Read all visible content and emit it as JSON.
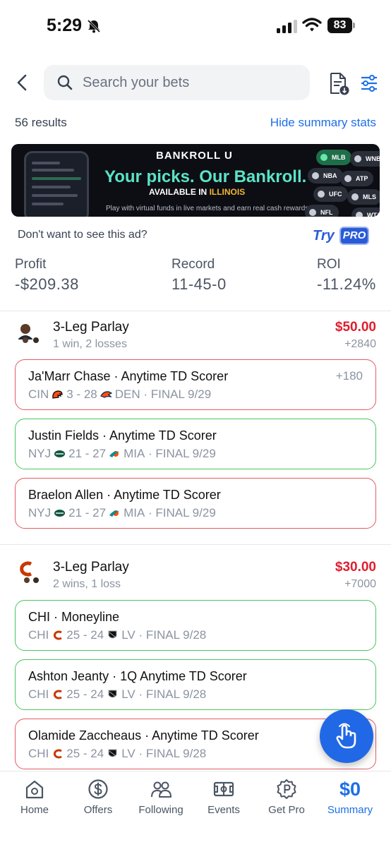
{
  "status_bar": {
    "time": "5:29",
    "battery": "83"
  },
  "header": {
    "search_placeholder": "Search your bets",
    "results_count": "56 results",
    "hide_stats_label": "Hide summary stats"
  },
  "ad": {
    "brand": "BANKROLL U",
    "headline": "Your picks. Our Bankroll.",
    "availability_prefix": "AVAILABLE IN",
    "availability_state": "ILLINOIS",
    "fine_print": "Play with virtual funds in live markets and earn real cash rewards.",
    "chips": [
      "MLB",
      "WNBA",
      "NBA",
      "ATP",
      "UFC",
      "MLS",
      "NFL",
      "WTA"
    ],
    "notice": "Don't want to see this ad?",
    "try_label": "Try",
    "pro_label": "PRO"
  },
  "stats": {
    "profit": {
      "label": "Profit",
      "value": "-$209.38"
    },
    "record": {
      "label": "Record",
      "value": "11-45-0"
    },
    "roi": {
      "label": "ROI",
      "value": "-11.24%"
    }
  },
  "parlays": [
    {
      "title": "3-Leg Parlay",
      "record": "1 win, 2 losses",
      "stake": "$50.00",
      "odds": "+2840",
      "legs": [
        {
          "title": "Ja'Marr Chase · Anytime TD Scorer",
          "odds": "+180",
          "team1": "CIN",
          "score": "3 - 28",
          "team2": "DEN",
          "status": "· FINAL 9/29",
          "result": "loss"
        },
        {
          "title": "Justin Fields · Anytime TD Scorer",
          "odds": "",
          "team1": "NYJ",
          "score": "21 - 27",
          "team2": "MIA",
          "status": "· FINAL 9/29",
          "result": "win"
        },
        {
          "title": "Braelon Allen · Anytime TD Scorer",
          "odds": "",
          "team1": "NYJ",
          "score": "21 - 27",
          "team2": "MIA",
          "status": "· FINAL 9/29",
          "result": "loss"
        }
      ]
    },
    {
      "title": "3-Leg Parlay",
      "record": "2 wins, 1 loss",
      "stake": "$30.00",
      "odds": "+7000",
      "legs": [
        {
          "title": "CHI · Moneyline",
          "odds": "",
          "team1": "CHI",
          "score": "25 - 24",
          "team2": "LV",
          "status": "· FINAL 9/28",
          "result": "win"
        },
        {
          "title": "Ashton Jeanty · 1Q Anytime TD Scorer",
          "odds": "",
          "team1": "CHI",
          "score": "25 - 24",
          "team2": "LV",
          "status": "· FINAL 9/28",
          "result": "win"
        },
        {
          "title": "Olamide Zaccheaus · Anytime TD Scorer",
          "odds": "",
          "team1": "CHI",
          "score": "25 - 24",
          "team2": "LV",
          "status": "· FINAL 9/28",
          "result": "loss"
        }
      ]
    }
  ],
  "tab_bar": {
    "tabs": [
      {
        "label": "Home",
        "icon": "home-icon"
      },
      {
        "label": "Offers",
        "icon": "dollar-circle-icon"
      },
      {
        "label": "Following",
        "icon": "people-icon"
      },
      {
        "label": "Events",
        "icon": "stadium-icon"
      },
      {
        "label": "Get Pro",
        "icon": "pro-badge-icon"
      },
      {
        "label": "Summary",
        "icon": "summary-value",
        "value": "$0"
      }
    ],
    "active": "Summary"
  },
  "colors": {
    "accent": "#1d6fe6",
    "loss": "#e45b64",
    "win": "#4cc45e",
    "stake": "#e11d2e",
    "fab": "#2168e6"
  }
}
